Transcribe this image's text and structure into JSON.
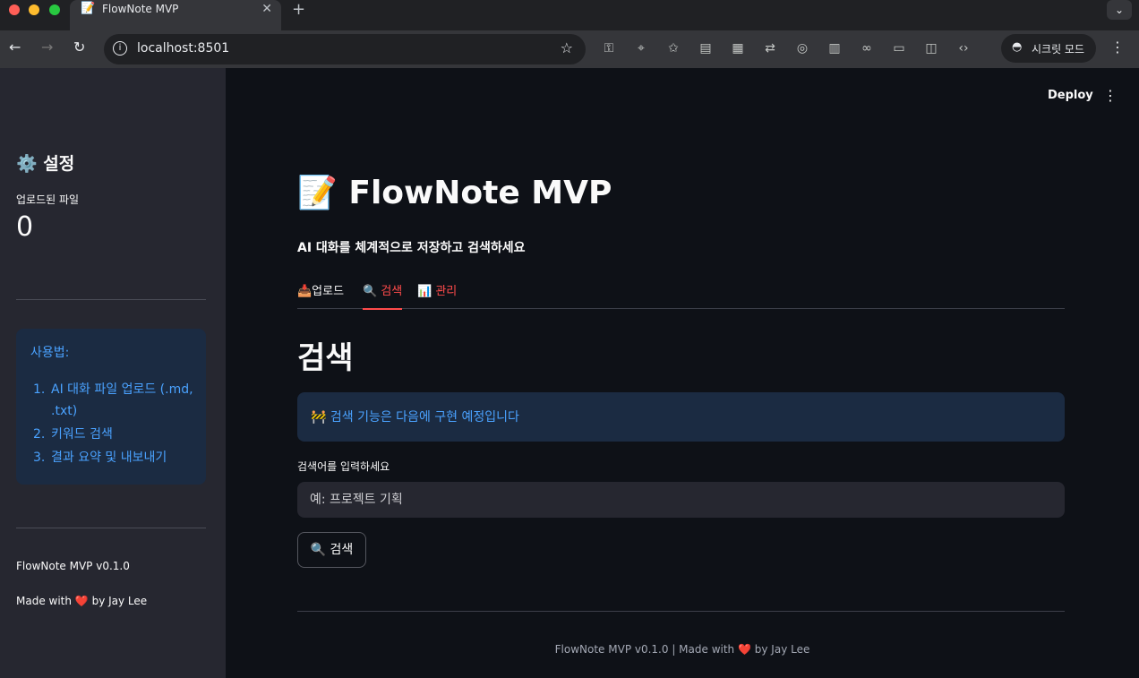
{
  "browser": {
    "tab_title": "FlowNote MVP",
    "tab_favicon": "📝",
    "url": "localhost:8501",
    "incognito_label": "시크릿 모드"
  },
  "sidebar": {
    "title": "⚙️ 설정",
    "metric_label": "업로드된 파일",
    "metric_value": "0",
    "usage_title": "사용법:",
    "usage_items": [
      {
        "num": "1.",
        "text": "AI 대화 파일 업로드 (.md, .txt)"
      },
      {
        "num": "2.",
        "text": "키워드 검색"
      },
      {
        "num": "3.",
        "text": "결과 요약 및 내보내기"
      }
    ],
    "version": "FlowNote MVP v0.1.0",
    "made_prefix": "Made with",
    "made_heart": "❤️",
    "made_suffix": "by Jay Lee"
  },
  "header": {
    "deploy_label": "Deploy"
  },
  "main": {
    "title": "📝 FlowNote MVP",
    "subtitle": "AI 대화를 체계적으로 저장하고 검색하세요",
    "tabs": [
      {
        "label": "📥업로드"
      },
      {
        "label": "🔍 검색"
      },
      {
        "label": "📊 관리"
      }
    ],
    "section_heading": "검색",
    "alert_text": "🚧 검색 기능은 다음에 구현 예정입니다",
    "input_label": "검색어를 입력하세요",
    "input_placeholder": "예: 프로젝트 기획",
    "search_button": "🔍 검색",
    "footer_prefix": "FlowNote MVP v0.1.0 | Made with",
    "footer_heart": "❤️",
    "footer_suffix": "by Jay Lee"
  },
  "colors": {
    "accent": "#ff4b4b",
    "info_text": "#4aa2ff",
    "info_bg": "#1b2b42",
    "sidebar_bg": "#262730",
    "main_bg": "#0e1117"
  },
  "icons": [
    "back-arrow-icon",
    "forward-arrow-icon",
    "reload-icon",
    "site-info-icon",
    "bookmark-star-icon",
    "key-icon",
    "location-icon",
    "reading-list-icon",
    "qr-code-icon",
    "translate-icon",
    "lens-icon",
    "reader-mode-icon",
    "link-icon",
    "cast-icon",
    "side-panel-icon",
    "devtools-icon",
    "incognito-icon",
    "more-vertical-icon",
    "close-icon",
    "plus-icon",
    "chevron-down-icon"
  ]
}
